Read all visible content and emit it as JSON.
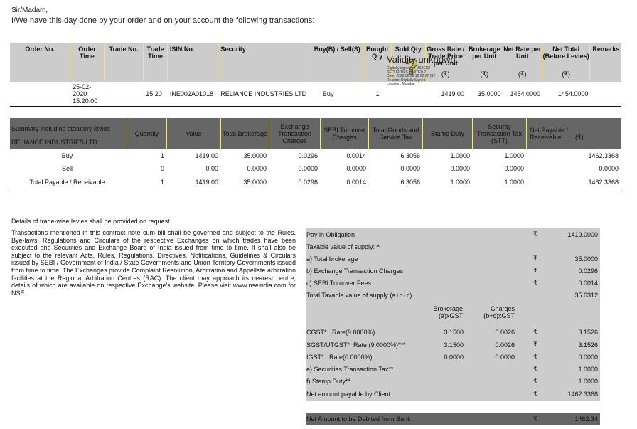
{
  "greeting": "Sir/Madam,",
  "intro": "I/We have this day done by your order and on your account the following transactions:",
  "trade_table": {
    "headers": {
      "order_no": "Order No.",
      "order_time": "Order Time",
      "trade_no": "Trade No.",
      "trade_time": "Trade Time",
      "isin": "ISIN No.",
      "security": "Security",
      "buy_sell": "Buy(B) / Sell(S)",
      "bought_qty": "Bought Qty",
      "sold_qty": "Sold Qty",
      "gross_rate": "Gross Rate / Trade Price per Unit",
      "brokerage": "Brokerage per Unit",
      "net_rate": "Net Rate per Unit",
      "net_total": "Net Total (Before Levies)",
      "remarks": "Remarks",
      "currency": "(₹)"
    },
    "rows": [
      {
        "order_no": "",
        "order_time": "25-02-2020 15:20:00",
        "trade_no": "",
        "trade_time": "15:20",
        "isin": "INE002A01018",
        "security": "RELIANCE INDUSTRIES LTD",
        "buy_sell": "Buy",
        "bought_qty": "1",
        "sold_qty": "",
        "gross_rate": "1419.00",
        "brokerage": "35.0000",
        "net_rate": "1454.0000",
        "net_total": "1454.0000",
        "remarks": ""
      }
    ]
  },
  "signature": {
    "validity": "Validity unknown",
    "line1": "Digitally signed by DS ICICI",
    "line2": "SECURITIES LIMITED 2",
    "line3": "Date: 2020.02.26 12:02:27 IST",
    "line4": "Reason: Digitally Signed",
    "line5": "Location: Mumbai"
  },
  "summary_table": {
    "title_line1": "Summary including statutory levies -",
    "title_line2": "RELIANCE INDUSTRIES LTD",
    "headers": {
      "quantity": "Quantity",
      "value": "Value",
      "total_brokerage": "Total Brokerage",
      "exchange_charges": "Exchange Transaction Charges",
      "sebi": "SEBI Turnover Charges",
      "gst": "Total Goods and Service Tax",
      "stamp": "Stamp Duty",
      "stt": "Security Transaction Tax (STT)",
      "net": "Net Payable / Receivable",
      "currency": "(₹)"
    },
    "rows": [
      {
        "label": "Buy",
        "quantity": "1",
        "value": "1419.00",
        "brokerage": "35.0000",
        "exchange": "0.0296",
        "sebi": "0.0014",
        "gst": "6.3056",
        "stamp": "1.0000",
        "stt": "1.0000",
        "net": "1462.3368"
      },
      {
        "label": "Sell",
        "quantity": "0",
        "value": "0.00",
        "brokerage": "0.0000",
        "exchange": "0.0000",
        "sebi": "0.0000",
        "gst": "0.0000",
        "stamp": "0.0000",
        "stt": "0.0000",
        "net": "0.0000"
      },
      {
        "label": "Total Payable / Receivable",
        "quantity": "1",
        "value": "1419.00",
        "brokerage": "35.0000",
        "exchange": "0.0296",
        "sebi": "0.0014",
        "gst": "6.3056",
        "stamp": "1.0000",
        "stt": "1.0000",
        "net": "1462.3368"
      }
    ]
  },
  "details_note": "Details of trade-wise levies shall be provided on request.",
  "legal_text": "Transactions mentioned in this contract note cum bill shall be governed and subject to the Rules, Bye-laws, Regulations and Circulars of the respective Exchanges on which trades have been executed and Securities and Exchange Board of India issued from time to time. It shall also be subject to the relevant Acts, Rules, Regulations, Directives, Notifications, Guidelines & Circulars issued by SEBI / Government of India / State Governments and Union Territory Governments issued from time to time. The Exchanges provide Complaint Resolution, Arbitration and Appellate arbitration facilities at the Regional Arbitration Centres (RAC). The client may approach its nearest centre, details of which are available on respective Exchange's website. Please visit www.nseindia.com for NSE.",
  "obligation": {
    "currency": "₹",
    "pay_in": {
      "label": "Pay in Obligation",
      "value": "1419.0000"
    },
    "taxable_heading": "Taxable value of supply: ^",
    "total_brokerage": {
      "label": "a) Total brokerage",
      "value": "35.0000"
    },
    "exchange_charges": {
      "label": "b) Exchange Transaction Charges",
      "value": "0.0296"
    },
    "sebi_fees": {
      "label": "c) SEBI Turnover Fees",
      "value": "0.0014"
    },
    "total_taxable": {
      "label": "Total Taxable value of supply (a+b+c)",
      "value": "35.0312"
    },
    "gst_head_brokerage": "Brokerage (a)xGST",
    "gst_head_charges": "Charges (b+c)xGST",
    "cgst": {
      "label": "CGST*   Rate(9.0000%)",
      "brokerage": "3.1500",
      "charges": "0.0026",
      "value": "3.1526"
    },
    "sgst": {
      "label": "SGST/UTGST*  Rate (9.0000%)***",
      "brokerage": "3.1500",
      "charges": "0.0026",
      "value": "3.1526"
    },
    "igst": {
      "label": "IGST*   Rate(0.0000%)",
      "brokerage": "0.0000",
      "charges": "0.0000",
      "value": "0.0000"
    },
    "stt": {
      "label": "e) Securities Transaction Tax**",
      "value": "1.0000"
    },
    "stamp": {
      "label": "f) Stamp Duty**",
      "value": "1.0000"
    },
    "net_payable": {
      "label": "Net amount payable by Client",
      "value": "1462.3368"
    }
  },
  "bank_debit": {
    "label": "Net Amount to be Debited from Bank",
    "currency": "₹",
    "value": "1462.34"
  }
}
